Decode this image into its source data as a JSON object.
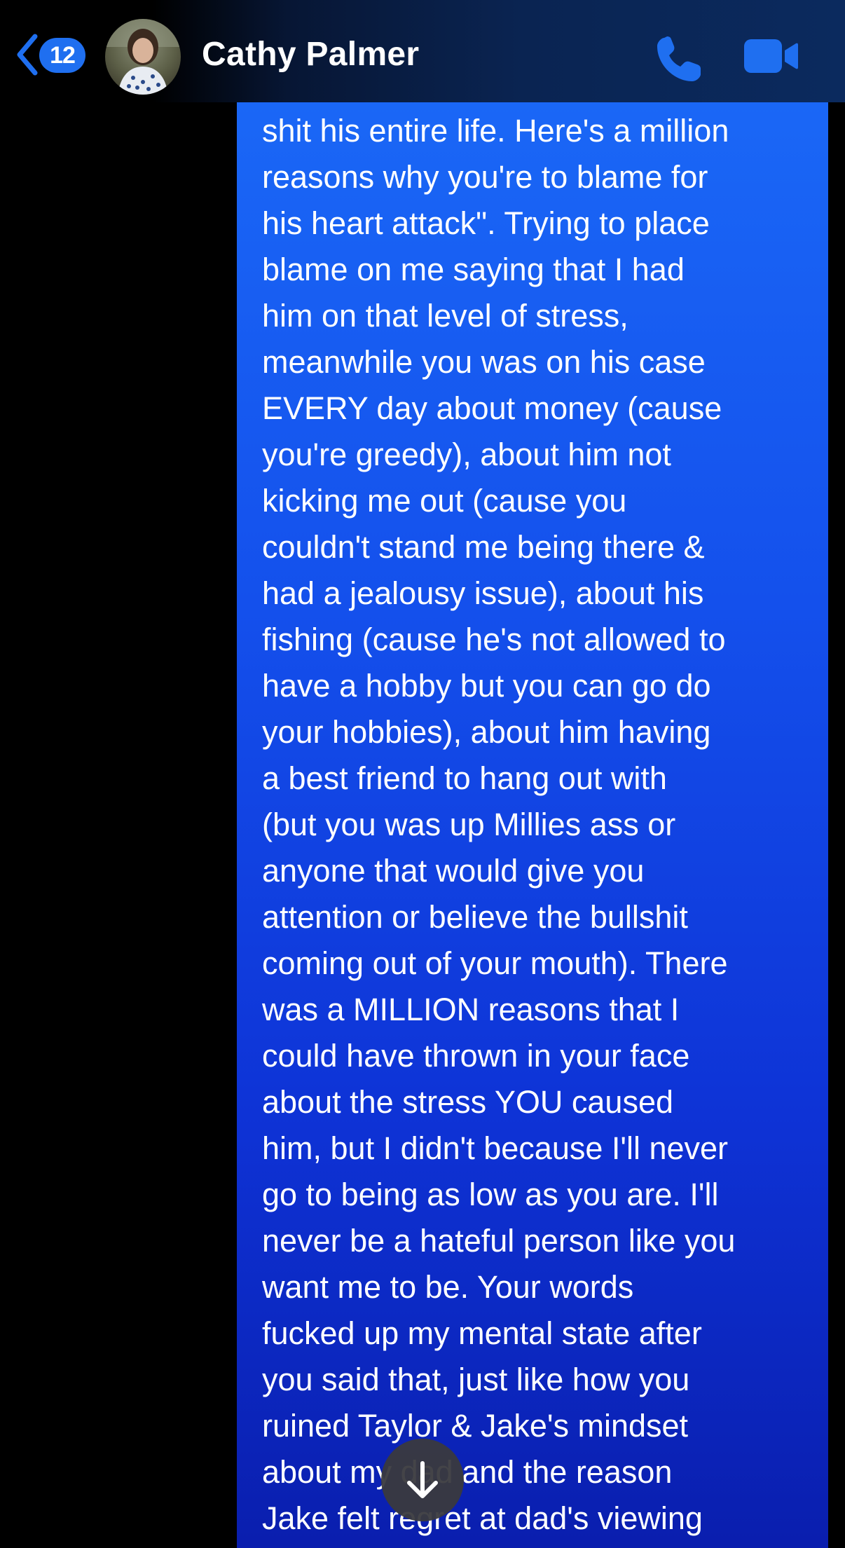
{
  "header": {
    "unread_count": "12",
    "contact_name": "Cathy Palmer",
    "icons": {
      "back": "chevron-left-icon",
      "call": "phone-icon",
      "video": "video-camera-icon"
    },
    "accent_color": "#1f6ff0"
  },
  "message": {
    "bubble_color": "#1a67f6",
    "lines": [
      "shit his entire life. Here's a million",
      "reasons why you're to blame for",
      "his heart attack\". Trying to place",
      "blame on me saying that I had",
      "him on that level of stress,",
      "meanwhile you was on his case",
      "EVERY day about money (cause",
      "you're greedy), about him not",
      "kicking me out (cause you",
      "couldn't stand me being there &",
      "had a jealousy issue), about his",
      "fishing (cause he's not allowed to",
      "have a hobby but you can go do",
      "your hobbies), about him having",
      "a best friend to hang out with",
      "(but you was up Millies ass or",
      "anyone that would give you",
      "attention or believe the bullshit",
      "coming out of your mouth). There",
      "was a MILLION reasons that I",
      "could have thrown in your face",
      "about the stress YOU caused",
      "him, but I didn't because I'll never",
      "go to being as low as you are. I'll",
      "never be a hateful person like you",
      "want me to be. Your words",
      "fucked up my mental state after",
      "you said that, just like how you",
      "ruined Taylor & Jake's mindset",
      "about my dad and the reason",
      "Jake felt regret at dad's viewing"
    ]
  },
  "scroll_button": {
    "icon": "arrow-down-icon"
  }
}
